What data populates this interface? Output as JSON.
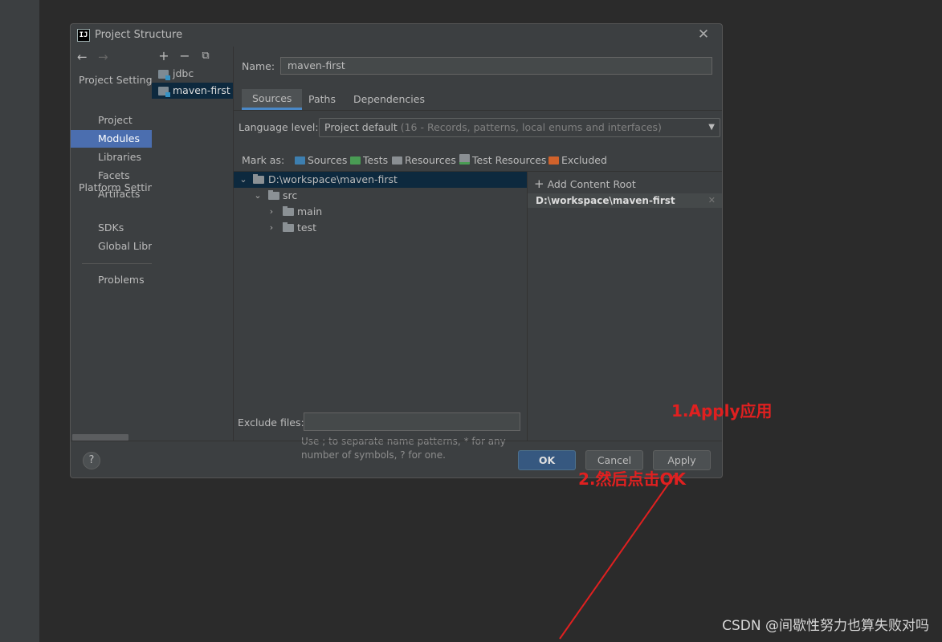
{
  "dialog": {
    "title": "Project Structure",
    "icon_text": "IJ"
  },
  "nav": {
    "project_settings_header": "Project Settings",
    "platform_settings_header": "Platform Settings",
    "items": [
      {
        "label": "Project"
      },
      {
        "label": "Modules",
        "selected": true
      },
      {
        "label": "Libraries"
      },
      {
        "label": "Facets"
      },
      {
        "label": "Artifacts"
      },
      {
        "label": "SDKs"
      },
      {
        "label": "Global Libraries"
      },
      {
        "label": "Problems"
      }
    ]
  },
  "modules": {
    "toolbar": {
      "add": "+",
      "remove": "−",
      "copy": "⧉"
    },
    "items": [
      {
        "label": "jdbc"
      },
      {
        "label": "maven-first",
        "selected": true
      }
    ]
  },
  "main": {
    "name_label": "Name:",
    "name_value": "maven-first",
    "tabs": [
      {
        "label": "Sources",
        "active": true
      },
      {
        "label": "Paths"
      },
      {
        "label": "Dependencies"
      }
    ],
    "language_level_label": "Language level:",
    "language_level_value": "Project default",
    "language_level_detail": "(16 - Records, patterns, local enums and interfaces)",
    "mark_as_label": "Mark as:",
    "mark_buttons": [
      {
        "label": "Sources",
        "color": "#3d7fb0"
      },
      {
        "label": "Tests",
        "color": "#499c54"
      },
      {
        "label": "Resources",
        "color": "#8a8f93"
      },
      {
        "label": "Test Resources",
        "color": "#8a8f93"
      },
      {
        "label": "Excluded",
        "color": "#d1622b"
      }
    ],
    "tree": [
      {
        "label": "D:\\workspace\\maven-first",
        "expanded": true,
        "depth": 0,
        "selected": true
      },
      {
        "label": "src",
        "expanded": true,
        "depth": 1
      },
      {
        "label": "main",
        "expanded": false,
        "depth": 2
      },
      {
        "label": "test",
        "expanded": false,
        "depth": 2
      }
    ],
    "exclude_files_label": "Exclude files:",
    "exclude_files_value": "",
    "hint_text_1": "Use ; to separate name patterns, * for any",
    "hint_text_2": "number of symbols, ? for one.",
    "add_content_root": "Add Content Root",
    "content_root": "D:\\workspace\\maven-first"
  },
  "footer": {
    "help": "?",
    "ok": "OK",
    "cancel": "Cancel",
    "apply": "Apply"
  },
  "annotations": {
    "step1": "1.Apply应用",
    "step2": "2.然后点击OK",
    "color": "#e02020"
  },
  "watermark": "CSDN @间歇性努力也算失败对吗"
}
